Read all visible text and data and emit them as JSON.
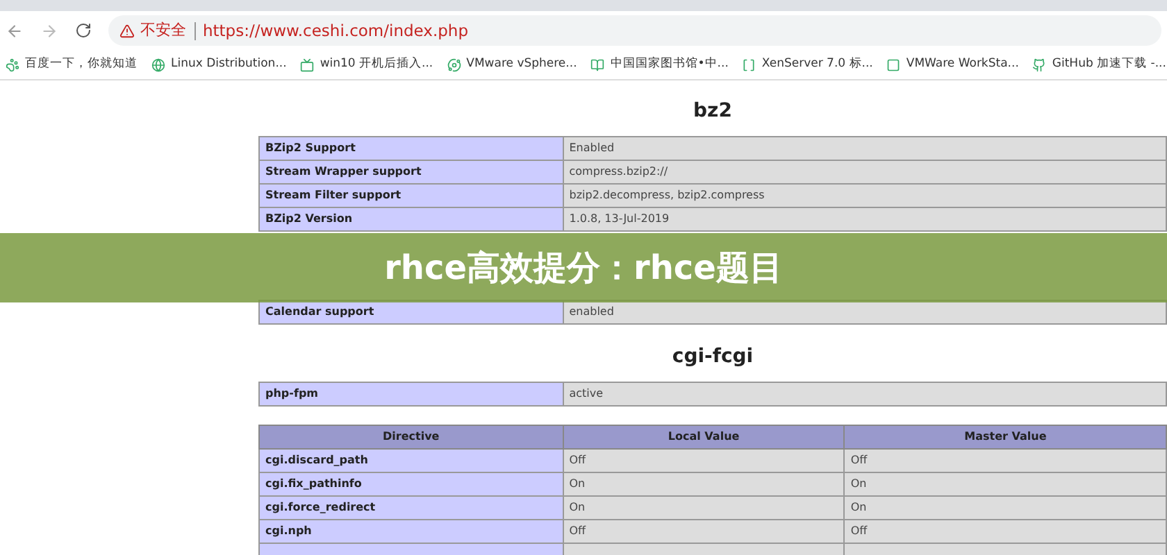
{
  "address_bar": {
    "warning": "不安全",
    "url": "https://www.ceshi.com/index.php"
  },
  "bookmarks": [
    {
      "label": "百度一下，你就知道"
    },
    {
      "label": "Linux Distribution..."
    },
    {
      "label": "win10 开机后插入..."
    },
    {
      "label": "VMware vSphere..."
    },
    {
      "label": "中国国家图书馆•中..."
    },
    {
      "label": "XenServer 7.0 标..."
    },
    {
      "label": "VMWare WorkSta..."
    },
    {
      "label": "GitHub 加速下载 -..."
    }
  ],
  "sections": [
    {
      "title": "bz2",
      "tables": [
        {
          "rows": [
            [
              "BZip2 Support",
              "Enabled"
            ],
            [
              "Stream Wrapper support",
              "compress.bzip2://"
            ],
            [
              "Stream Filter support",
              "bzip2.decompress, bzip2.compress"
            ],
            [
              "BZip2 Version",
              "1.0.8, 13-Jul-2019"
            ]
          ]
        }
      ]
    },
    {
      "tables": [
        {
          "rows": [
            [
              "Calendar support",
              "enabled"
            ]
          ]
        }
      ]
    },
    {
      "title": "cgi-fcgi",
      "tables": [
        {
          "rows": [
            [
              "php-fpm",
              "active"
            ]
          ]
        },
        {
          "columns": [
            "Directive",
            "Local Value",
            "Master Value"
          ],
          "rows": [
            [
              "cgi.discard_path",
              "Off",
              "Off"
            ],
            [
              "cgi.fix_pathinfo",
              "On",
              "On"
            ],
            [
              "cgi.force_redirect",
              "On",
              "On"
            ],
            [
              "cgi.nph",
              "Off",
              "Off"
            ],
            [
              "",
              "",
              ""
            ]
          ]
        }
      ]
    }
  ],
  "banner": {
    "title": "rhce高效提分：rhce题目"
  }
}
